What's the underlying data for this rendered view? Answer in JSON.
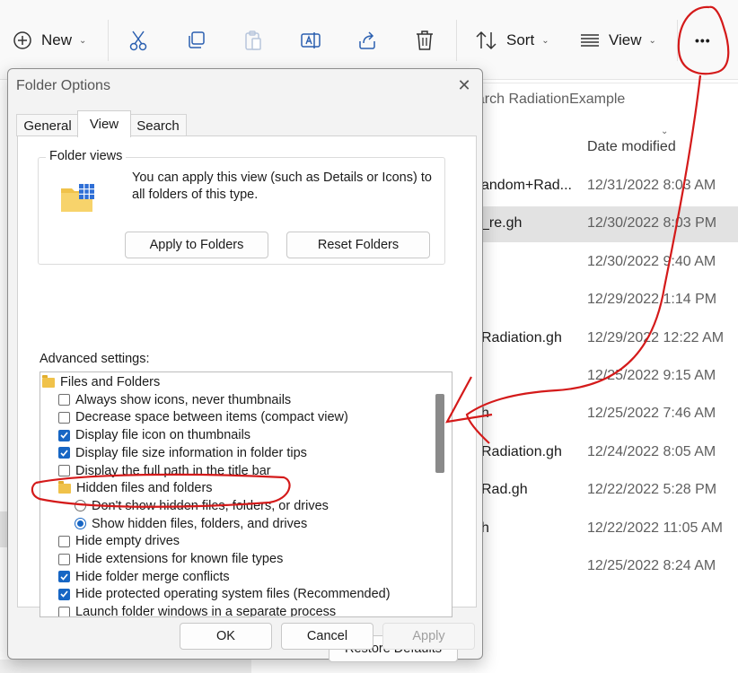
{
  "toolbar": {
    "new_label": "New",
    "sort_label": "Sort",
    "view_label": "View",
    "more_label": "•••",
    "icons": [
      "plus-circle-icon",
      "cut-icon",
      "copy-icon",
      "paste-icon",
      "rename-icon",
      "share-icon",
      "delete-icon",
      "sort-icon",
      "view-icon",
      "more-icon"
    ]
  },
  "explorer": {
    "search_placeholder": "earch RadiationExample",
    "date_header": "Date modified",
    "rows": [
      {
        "name": "andom+Rad...",
        "date": "12/31/2022 8:03 AM"
      },
      {
        "name": "_re.gh",
        "date": "12/30/2022 8:03 PM"
      },
      {
        "name": "",
        "date": "12/30/2022 9:40 AM"
      },
      {
        "name": "",
        "date": "12/29/2022 1:14 PM"
      },
      {
        "name": "Radiation.gh",
        "date": "12/29/2022 12:22 AM"
      },
      {
        "name": "",
        "date": "12/25/2022 9:15 AM"
      },
      {
        "name": "h",
        "date": "12/25/2022 7:46 AM"
      },
      {
        "name": "Radiation.gh",
        "date": "12/24/2022 8:05 AM"
      },
      {
        "name": "Rad.gh",
        "date": "12/22/2022 5:28 PM"
      },
      {
        "name": "h",
        "date": "12/22/2022 11:05 AM"
      },
      {
        "name": "",
        "date": "12/25/2022 8:24 AM"
      }
    ]
  },
  "dialog": {
    "title": "Folder Options",
    "close": "✕",
    "tabs": [
      "General",
      "View",
      "Search"
    ],
    "active_tab": "View",
    "folder_views": {
      "label": "Folder views",
      "description": "You can apply this view (such as Details or Icons) to all folders of this type.",
      "apply_btn": "Apply to Folders",
      "reset_btn": "Reset Folders"
    },
    "advanced_label": "Advanced settings:",
    "settings": [
      {
        "type": "folder",
        "label": "Files and Folders",
        "indent": 0
      },
      {
        "type": "checkbox",
        "label": "Always show icons, never thumbnails",
        "checked": false,
        "indent": 1
      },
      {
        "type": "checkbox",
        "label": "Decrease space between items (compact view)",
        "checked": false,
        "indent": 1
      },
      {
        "type": "checkbox",
        "label": "Display file icon on thumbnails",
        "checked": true,
        "indent": 1
      },
      {
        "type": "checkbox",
        "label": "Display file size information in folder tips",
        "checked": true,
        "indent": 1
      },
      {
        "type": "checkbox",
        "label": "Display the full path in the title bar",
        "checked": false,
        "indent": 1
      },
      {
        "type": "folder",
        "label": "Hidden files and folders",
        "indent": 1
      },
      {
        "type": "radio",
        "label": "Don't show hidden files, folders, or drives",
        "checked": false,
        "indent": 2
      },
      {
        "type": "radio",
        "label": "Show hidden files, folders, and drives",
        "checked": true,
        "indent": 2
      },
      {
        "type": "checkbox",
        "label": "Hide empty drives",
        "checked": false,
        "indent": 1
      },
      {
        "type": "checkbox",
        "label": "Hide extensions for known file types",
        "checked": false,
        "indent": 1
      },
      {
        "type": "checkbox",
        "label": "Hide folder merge conflicts",
        "checked": true,
        "indent": 1
      },
      {
        "type": "checkbox",
        "label": "Hide protected operating system files (Recommended)",
        "checked": true,
        "indent": 1
      },
      {
        "type": "checkbox",
        "label": "Launch folder windows in a separate process",
        "checked": false,
        "indent": 1
      }
    ],
    "restore_btn": "Restore Defaults",
    "ok_btn": "OK",
    "cancel_btn": "Cancel",
    "apply_btn": "Apply"
  },
  "colors": {
    "accent": "#1766c4",
    "annotation": "#d41a1a"
  }
}
